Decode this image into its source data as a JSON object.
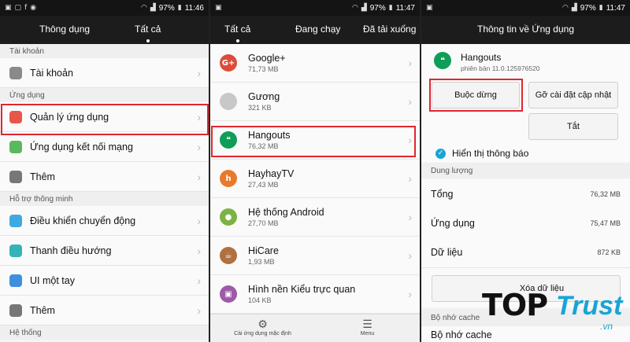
{
  "status": {
    "panel1_time": "11:46",
    "panel2_time": "11:47",
    "panel3_time": "11:47",
    "battery": "97%"
  },
  "panel1": {
    "tabs": [
      "Thông dụng",
      "Tất cả"
    ],
    "sections": [
      {
        "header": "Tài khoản",
        "items": [
          {
            "label": "Tài khoản",
            "icon": "account-icon",
            "color": "#8a8a8a"
          }
        ]
      },
      {
        "header": "Ứng dụng",
        "items": [
          {
            "label": "Quản lý ứng dụng",
            "icon": "apps-grid-icon",
            "color": "#e8564a"
          },
          {
            "label": "Ứng dụng kết nối mạng",
            "icon": "network-app-icon",
            "color": "#5cb85c"
          },
          {
            "label": "Thêm",
            "icon": "more-icon",
            "color": "#777777"
          }
        ]
      },
      {
        "header": "Hỗ trợ thông minh",
        "items": [
          {
            "label": "Điều khiển chuyển động",
            "icon": "motion-icon",
            "color": "#3fa9e0"
          },
          {
            "label": "Thanh điều hướng",
            "icon": "navbar-icon",
            "color": "#33b5b5"
          },
          {
            "label": "UI một tay",
            "icon": "one-hand-icon",
            "color": "#3f8fe0"
          },
          {
            "label": "Thêm",
            "icon": "more-icon",
            "color": "#777777"
          }
        ]
      },
      {
        "header": "Hệ thống",
        "items": []
      }
    ]
  },
  "panel2": {
    "tabs": [
      "Tất cả",
      "Đang chạy",
      "Đã tải xuống"
    ],
    "apps": [
      {
        "name": "Google+",
        "size": "71,73 MB",
        "icon": "google-plus-icon",
        "color": "#dd4b39",
        "glyph": "G+"
      },
      {
        "name": "Gương",
        "size": "321 KB",
        "icon": "mirror-icon",
        "color": "#c8c8c8",
        "glyph": ""
      },
      {
        "name": "Hangouts",
        "size": "76,32 MB",
        "icon": "hangouts-icon",
        "color": "#0f9d58",
        "glyph": "❝"
      },
      {
        "name": "HayhayTV",
        "size": "27,43 MB",
        "icon": "hayhaytv-icon",
        "color": "#e87a2d",
        "glyph": "h"
      },
      {
        "name": "Hệ thống Android",
        "size": "27,70 MB",
        "icon": "android-system-icon",
        "color": "#7cb342",
        "glyph": "●"
      },
      {
        "name": "HiCare",
        "size": "1,93 MB",
        "icon": "hicare-icon",
        "color": "#b07040",
        "glyph": "☕"
      },
      {
        "name": "Hình nền Kiểu trực quan",
        "size": "104 KB",
        "icon": "wallpaper-icon",
        "color": "#9c5aa8",
        "glyph": "▣"
      }
    ],
    "bottom": [
      {
        "label": "Cài ứng dụng mặc định",
        "icon": "settings-gear-icon",
        "glyph": "⚙"
      },
      {
        "label": "Menu",
        "icon": "menu-icon",
        "glyph": "☰"
      }
    ]
  },
  "panel3": {
    "title": "Thông tin về Ứng dụng",
    "app_name": "Hangouts",
    "version": "phiên bản 11.0.125976520",
    "force_stop": "Buộc dừng",
    "uninstall_updates": "Gỡ cài đặt cập nhật",
    "disable": "Tắt",
    "show_notifications": "Hiển thị thông báo",
    "storage_header": "Dung lượng",
    "storage": [
      {
        "label": "Tổng",
        "value": "76,32 MB"
      },
      {
        "label": "Ứng dụng",
        "value": "75,47 MB"
      },
      {
        "label": "Dữ liệu",
        "value": "872 KB"
      }
    ],
    "clear_data": "Xóa dữ liệu",
    "cache_header": "Bộ nhớ cache",
    "cache_row": "Bộ nhớ cache"
  },
  "watermark": {
    "top": "TOP",
    "trust": "Trust",
    "domain": ".vn"
  },
  "colors": {
    "highlight": "#e0272f",
    "accent": "#19a4d6",
    "toolbar": "#1c1c1c"
  }
}
